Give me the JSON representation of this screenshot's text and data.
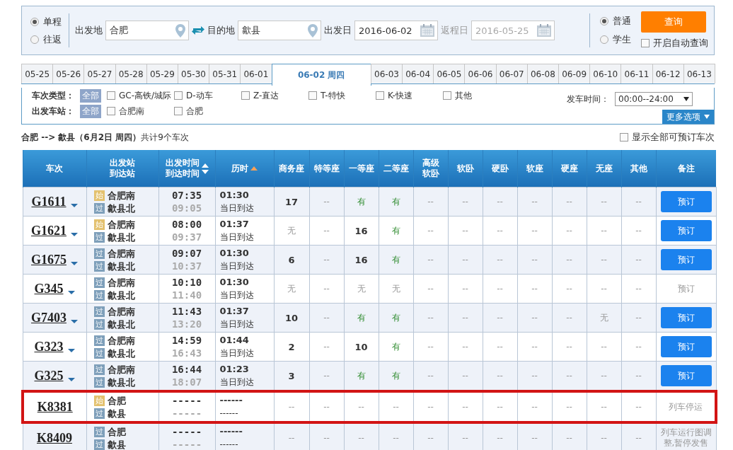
{
  "search": {
    "trip_types": [
      {
        "label": "单程",
        "selected": true
      },
      {
        "label": "往返",
        "selected": false
      }
    ],
    "from": {
      "label": "出发地",
      "value": "合肥"
    },
    "to": {
      "label": "目的地",
      "value": "歙县"
    },
    "depart_date": {
      "label": "出发日",
      "value": "2016-06-02"
    },
    "return_date": {
      "label": "返程日",
      "value": "2016-05-25",
      "disabled": true
    },
    "passenger_types": [
      {
        "label": "普通",
        "selected": true
      },
      {
        "label": "学生",
        "selected": false
      }
    ],
    "query_button": "查询",
    "auto_query": {
      "label": "开启自动查询",
      "checked": false
    }
  },
  "date_tabs": [
    {
      "label": "05-25",
      "selected": false
    },
    {
      "label": "05-26",
      "selected": false
    },
    {
      "label": "05-27",
      "selected": false
    },
    {
      "label": "05-28",
      "selected": false
    },
    {
      "label": "05-29",
      "selected": false
    },
    {
      "label": "05-30",
      "selected": false
    },
    {
      "label": "05-31",
      "selected": false
    },
    {
      "label": "06-01",
      "selected": false
    },
    {
      "label": "06-02 周四",
      "selected": true
    },
    {
      "label": "06-03",
      "selected": false
    },
    {
      "label": "06-04",
      "selected": false
    },
    {
      "label": "06-05",
      "selected": false
    },
    {
      "label": "06-06",
      "selected": false
    },
    {
      "label": "06-07",
      "selected": false
    },
    {
      "label": "06-08",
      "selected": false
    },
    {
      "label": "06-09",
      "selected": false
    },
    {
      "label": "06-10",
      "selected": false
    },
    {
      "label": "06-11",
      "selected": false
    },
    {
      "label": "06-12",
      "selected": false
    },
    {
      "label": "06-13",
      "selected": false
    }
  ],
  "filters": {
    "groups": [
      {
        "label": "车次类型：",
        "all": {
          "label": "全部",
          "selected": true
        },
        "options": [
          {
            "label": "GC-高铁/城际",
            "checked": false
          },
          {
            "label": "D-动车",
            "checked": false
          },
          {
            "label": "Z-直达",
            "checked": false
          },
          {
            "label": "T-特快",
            "checked": false
          },
          {
            "label": "K-快速",
            "checked": false
          },
          {
            "label": "其他",
            "checked": false
          }
        ]
      },
      {
        "label": "出发车站：",
        "all": {
          "label": "全部",
          "selected": true
        },
        "options": [
          {
            "label": "合肥南",
            "checked": false
          },
          {
            "label": "合肥",
            "checked": false
          }
        ]
      }
    ],
    "time": {
      "label": "发车时间：",
      "value": "00:00--24:00"
    },
    "more_button": "更多选项"
  },
  "summary": {
    "text": "**合肥 --> 歙县（6月2日  周四）**共计9个车次",
    "show_all": {
      "label": "显示全部可预订车次",
      "checked": false
    }
  },
  "table": {
    "columns": [
      {
        "label": [
          "车次"
        ]
      },
      {
        "label": [
          "出发站",
          "到达站"
        ]
      },
      {
        "label": [
          "出发时间",
          "到达时间"
        ],
        "sort": [
          {
            "kind": "up",
            "active": false
          },
          {
            "kind": "down",
            "active": false
          }
        ]
      },
      {
        "label": [
          "历时"
        ],
        "sort": [
          {
            "kind": "up",
            "active": true
          }
        ]
      },
      {
        "label": [
          "商务座"
        ]
      },
      {
        "label": [
          "特等座"
        ]
      },
      {
        "label": [
          "一等座"
        ]
      },
      {
        "label": [
          "二等座"
        ]
      },
      {
        "label": [
          "高级",
          "软卧"
        ]
      },
      {
        "label": [
          "软卧"
        ]
      },
      {
        "label": [
          "硬卧"
        ]
      },
      {
        "label": [
          "软座"
        ]
      },
      {
        "label": [
          "硬座"
        ]
      },
      {
        "label": [
          "无座"
        ]
      },
      {
        "label": [
          "其他"
        ]
      },
      {
        "label": [
          "备注"
        ]
      }
    ],
    "rows": [
      {
        "train": "G1611",
        "details": true,
        "highlighted": false,
        "from": {
          "badge": "始",
          "kind": "start",
          "name": "合肥南"
        },
        "to": {
          "badge": "过",
          "kind": "pass",
          "name": "歙县北"
        },
        "depart": "07:35",
        "arrive": "09:05",
        "duration": "01:30",
        "arrival_day": "当日到达",
        "seats": [
          {
            "t": "17",
            "kind": "count"
          },
          {
            "t": "--",
            "kind": "dash"
          },
          {
            "t": "有",
            "kind": "available"
          },
          {
            "t": "有",
            "kind": "available"
          },
          {
            "t": "--",
            "kind": "dash"
          },
          {
            "t": "--",
            "kind": "dash"
          },
          {
            "t": "--",
            "kind": "dash"
          },
          {
            "t": "--",
            "kind": "dash"
          },
          {
            "t": "--",
            "kind": "dash"
          },
          {
            "t": "--",
            "kind": "dash"
          },
          {
            "t": "--",
            "kind": "dash"
          }
        ],
        "remark": {
          "kind": "button",
          "text": "预订",
          "disabled": false
        }
      },
      {
        "train": "G1621",
        "details": true,
        "highlighted": false,
        "from": {
          "badge": "始",
          "kind": "start",
          "name": "合肥南"
        },
        "to": {
          "badge": "过",
          "kind": "pass",
          "name": "歙县北"
        },
        "depart": "08:00",
        "arrive": "09:37",
        "duration": "01:37",
        "arrival_day": "当日到达",
        "seats": [
          {
            "t": "无",
            "kind": "none"
          },
          {
            "t": "--",
            "kind": "dash"
          },
          {
            "t": "16",
            "kind": "count"
          },
          {
            "t": "有",
            "kind": "available"
          },
          {
            "t": "--",
            "kind": "dash"
          },
          {
            "t": "--",
            "kind": "dash"
          },
          {
            "t": "--",
            "kind": "dash"
          },
          {
            "t": "--",
            "kind": "dash"
          },
          {
            "t": "--",
            "kind": "dash"
          },
          {
            "t": "--",
            "kind": "dash"
          },
          {
            "t": "--",
            "kind": "dash"
          }
        ],
        "remark": {
          "kind": "button",
          "text": "预订",
          "disabled": false
        }
      },
      {
        "train": "G1675",
        "details": true,
        "highlighted": false,
        "from": {
          "badge": "过",
          "kind": "pass",
          "name": "合肥南"
        },
        "to": {
          "badge": "过",
          "kind": "pass",
          "name": "歙县北"
        },
        "depart": "09:07",
        "arrive": "10:37",
        "duration": "01:30",
        "arrival_day": "当日到达",
        "seats": [
          {
            "t": "6",
            "kind": "count"
          },
          {
            "t": "--",
            "kind": "dash"
          },
          {
            "t": "16",
            "kind": "count"
          },
          {
            "t": "有",
            "kind": "available"
          },
          {
            "t": "--",
            "kind": "dash"
          },
          {
            "t": "--",
            "kind": "dash"
          },
          {
            "t": "--",
            "kind": "dash"
          },
          {
            "t": "--",
            "kind": "dash"
          },
          {
            "t": "--",
            "kind": "dash"
          },
          {
            "t": "--",
            "kind": "dash"
          },
          {
            "t": "--",
            "kind": "dash"
          }
        ],
        "remark": {
          "kind": "button",
          "text": "预订",
          "disabled": false
        }
      },
      {
        "train": "G345",
        "details": true,
        "highlighted": false,
        "from": {
          "badge": "过",
          "kind": "pass",
          "name": "合肥南"
        },
        "to": {
          "badge": "过",
          "kind": "pass",
          "name": "歙县北"
        },
        "depart": "10:10",
        "arrive": "11:40",
        "duration": "01:30",
        "arrival_day": "当日到达",
        "seats": [
          {
            "t": "无",
            "kind": "none"
          },
          {
            "t": "--",
            "kind": "dash"
          },
          {
            "t": "无",
            "kind": "none"
          },
          {
            "t": "无",
            "kind": "none"
          },
          {
            "t": "--",
            "kind": "dash"
          },
          {
            "t": "--",
            "kind": "dash"
          },
          {
            "t": "--",
            "kind": "dash"
          },
          {
            "t": "--",
            "kind": "dash"
          },
          {
            "t": "--",
            "kind": "dash"
          },
          {
            "t": "--",
            "kind": "dash"
          },
          {
            "t": "--",
            "kind": "dash"
          }
        ],
        "remark": {
          "kind": "button",
          "text": "预订",
          "disabled": true
        }
      },
      {
        "train": "G7403",
        "details": true,
        "highlighted": false,
        "from": {
          "badge": "过",
          "kind": "pass",
          "name": "合肥南"
        },
        "to": {
          "badge": "过",
          "kind": "pass",
          "name": "歙县北"
        },
        "depart": "11:43",
        "arrive": "13:20",
        "duration": "01:37",
        "arrival_day": "当日到达",
        "seats": [
          {
            "t": "10",
            "kind": "count"
          },
          {
            "t": "--",
            "kind": "dash"
          },
          {
            "t": "有",
            "kind": "available"
          },
          {
            "t": "有",
            "kind": "available"
          },
          {
            "t": "--",
            "kind": "dash"
          },
          {
            "t": "--",
            "kind": "dash"
          },
          {
            "t": "--",
            "kind": "dash"
          },
          {
            "t": "--",
            "kind": "dash"
          },
          {
            "t": "--",
            "kind": "dash"
          },
          {
            "t": "无",
            "kind": "none"
          },
          {
            "t": "--",
            "kind": "dash"
          }
        ],
        "remark": {
          "kind": "button",
          "text": "预订",
          "disabled": false
        }
      },
      {
        "train": "G323",
        "details": true,
        "highlighted": false,
        "from": {
          "badge": "过",
          "kind": "pass",
          "name": "合肥南"
        },
        "to": {
          "badge": "过",
          "kind": "pass",
          "name": "歙县北"
        },
        "depart": "14:59",
        "arrive": "16:43",
        "duration": "01:44",
        "arrival_day": "当日到达",
        "seats": [
          {
            "t": "2",
            "kind": "count"
          },
          {
            "t": "--",
            "kind": "dash"
          },
          {
            "t": "10",
            "kind": "count"
          },
          {
            "t": "有",
            "kind": "available"
          },
          {
            "t": "--",
            "kind": "dash"
          },
          {
            "t": "--",
            "kind": "dash"
          },
          {
            "t": "--",
            "kind": "dash"
          },
          {
            "t": "--",
            "kind": "dash"
          },
          {
            "t": "--",
            "kind": "dash"
          },
          {
            "t": "--",
            "kind": "dash"
          },
          {
            "t": "--",
            "kind": "dash"
          }
        ],
        "remark": {
          "kind": "button",
          "text": "预订",
          "disabled": false
        }
      },
      {
        "train": "G325",
        "details": true,
        "highlighted": false,
        "from": {
          "badge": "过",
          "kind": "pass",
          "name": "合肥南"
        },
        "to": {
          "badge": "过",
          "kind": "pass",
          "name": "歙县北"
        },
        "depart": "16:44",
        "arrive": "18:07",
        "duration": "01:23",
        "arrival_day": "当日到达",
        "seats": [
          {
            "t": "3",
            "kind": "count"
          },
          {
            "t": "--",
            "kind": "dash"
          },
          {
            "t": "有",
            "kind": "available"
          },
          {
            "t": "有",
            "kind": "available"
          },
          {
            "t": "--",
            "kind": "dash"
          },
          {
            "t": "--",
            "kind": "dash"
          },
          {
            "t": "--",
            "kind": "dash"
          },
          {
            "t": "--",
            "kind": "dash"
          },
          {
            "t": "--",
            "kind": "dash"
          },
          {
            "t": "--",
            "kind": "dash"
          },
          {
            "t": "--",
            "kind": "dash"
          }
        ],
        "remark": {
          "kind": "button",
          "text": "预订",
          "disabled": false
        }
      },
      {
        "train": "K8381",
        "details": false,
        "highlighted": true,
        "from": {
          "badge": "始",
          "kind": "start",
          "name": "合肥"
        },
        "to": {
          "badge": "过",
          "kind": "pass",
          "name": "歙县"
        },
        "depart": "-----",
        "arrive": "-----",
        "duration": "------",
        "arrival_day": "------",
        "seats": [
          {
            "t": "--",
            "kind": "dash"
          },
          {
            "t": "--",
            "kind": "dash"
          },
          {
            "t": "--",
            "kind": "dash"
          },
          {
            "t": "--",
            "kind": "dash"
          },
          {
            "t": "--",
            "kind": "dash"
          },
          {
            "t": "--",
            "kind": "dash"
          },
          {
            "t": "--",
            "kind": "dash"
          },
          {
            "t": "--",
            "kind": "dash"
          },
          {
            "t": "--",
            "kind": "dash"
          },
          {
            "t": "--",
            "kind": "dash"
          },
          {
            "t": "--",
            "kind": "dash"
          }
        ],
        "remark": {
          "kind": "note",
          "text": "列车停运"
        }
      },
      {
        "train": "K8409",
        "details": false,
        "highlighted": false,
        "from": {
          "badge": "过",
          "kind": "pass",
          "name": "合肥"
        },
        "to": {
          "badge": "过",
          "kind": "pass",
          "name": "歙县"
        },
        "depart": "-----",
        "arrive": "-----",
        "duration": "------",
        "arrival_day": "------",
        "seats": [
          {
            "t": "--",
            "kind": "dash"
          },
          {
            "t": "--",
            "kind": "dash"
          },
          {
            "t": "--",
            "kind": "dash"
          },
          {
            "t": "--",
            "kind": "dash"
          },
          {
            "t": "--",
            "kind": "dash"
          },
          {
            "t": "--",
            "kind": "dash"
          },
          {
            "t": "--",
            "kind": "dash"
          },
          {
            "t": "--",
            "kind": "dash"
          },
          {
            "t": "--",
            "kind": "dash"
          },
          {
            "t": "--",
            "kind": "dash"
          },
          {
            "t": "--",
            "kind": "dash"
          }
        ],
        "remark": {
          "kind": "note",
          "text": "列车运行图调整,暂停发售"
        }
      }
    ]
  }
}
